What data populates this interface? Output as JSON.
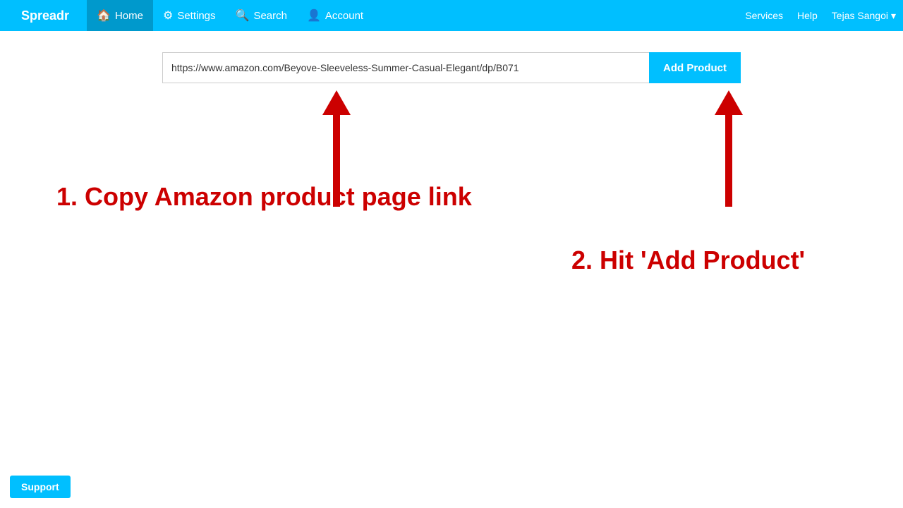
{
  "navbar": {
    "brand": "Spreadr",
    "items": [
      {
        "label": "Home",
        "icon": "🏠",
        "active": true
      },
      {
        "label": "Settings",
        "icon": "⚙"
      },
      {
        "label": "Search",
        "icon": "🔍"
      },
      {
        "label": "Account",
        "icon": "👤"
      }
    ],
    "right": {
      "services": "Services",
      "help": "Help",
      "user": "Tejas Sangoi",
      "dropdown": "▾"
    }
  },
  "url_bar": {
    "placeholder": "",
    "value": "https://www.amazon.com/Beyove-Sleeveless-Summer-Casual-Elegant/dp/B071",
    "button_label": "Add Product"
  },
  "instructions": {
    "step1": "1. Copy Amazon product page link",
    "step2": "2. Hit 'Add Product'"
  },
  "support": {
    "label": "Support"
  }
}
